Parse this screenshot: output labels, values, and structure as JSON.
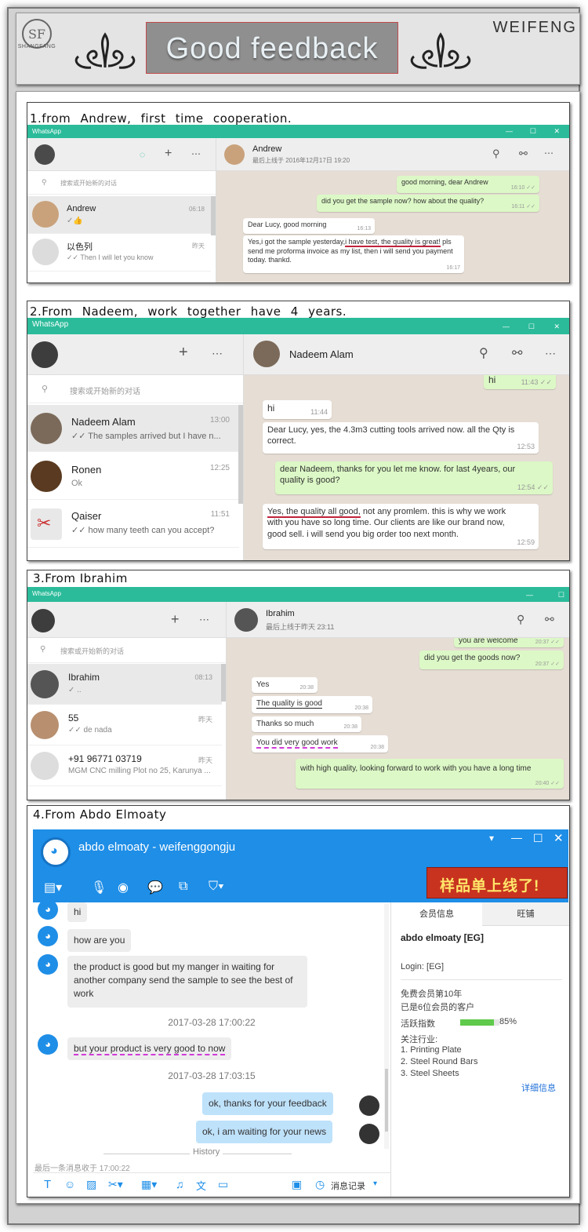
{
  "header": {
    "logo_text": "SHANGFANG",
    "logo_letters": "SF",
    "title": "Good  feedback",
    "brand": "WEIFENG"
  },
  "colors": {
    "whatsapp": "#2bbb9a",
    "qq_blue": "#1e8ee7",
    "bubble_out": "#dcf8c6",
    "chat_bg": "#e6ddd4"
  },
  "s1": {
    "title": "1.from  Andrew,  first  time  cooperation.",
    "app_name": "WhatsApp",
    "search_placeholder": "搜索或开始新的对话",
    "header_name": "Andrew",
    "header_status": "最后上线于 2016年12月17日 19:20",
    "contacts": [
      {
        "name": "Andrew",
        "msg": "✓👍",
        "time": "06:18"
      },
      {
        "name": "以色列",
        "msg": "✓✓ Then I will let you know",
        "time": "昨天"
      }
    ],
    "messages": [
      {
        "text": "good morning, dear Andrew",
        "time": "16:10 ✓✓"
      },
      {
        "text": "did you get the sample now? how about the quality?",
        "time": "16:11 ✓✓"
      },
      {
        "text": "Dear Lucy, good morning",
        "time": "16:13"
      },
      {
        "pre": "Yes,i got the sample yesterday,",
        "hl": "i have test, the quality is great!",
        "post": " pls send me proforma invoice as my list, then i will send you payment today. thankd.",
        "time": "16:17"
      }
    ]
  },
  "s2": {
    "title": "2.From  Nadeem,  work  together  have  4  years.",
    "app_name": "WhatsApp",
    "search_placeholder": "搜索或开始新的对话",
    "header_name": "Nadeem Alam",
    "contacts": [
      {
        "name": "Nadeem Alam",
        "msg": "✓✓ The samples arrived but I have n...",
        "time": "13:00"
      },
      {
        "name": "Ronen",
        "msg": "Ok",
        "time": "12:25"
      },
      {
        "name": "Qaiser",
        "msg": "✓✓ how many teeth can you accept?",
        "time": "11:51"
      }
    ],
    "messages": [
      {
        "text": "hi",
        "time": "11:43 ✓✓"
      },
      {
        "text": "hi",
        "time": "11:44"
      },
      {
        "text": "Dear Lucy, yes, the 4.3m3 cutting tools arrived now. all the Qty is correct.",
        "time": "12:53"
      },
      {
        "text": "dear Nadeem, thanks for you let me know. for last 4years, our quality is good?",
        "time": "12:54 ✓✓"
      },
      {
        "hl": "Yes, the quality all good,",
        "post": " not any promlem. this is  why we work with you have so long time. Our clients are like our brand now, good sell. i will send you big order too next month.",
        "time": "12:59"
      }
    ]
  },
  "s3": {
    "title": "3.From Ibrahim",
    "app_name": "WhatsApp",
    "search_placeholder": "搜索或开始新的对话",
    "header_name": "Ibrahim",
    "header_status": "最后上线于昨天 23:11",
    "contacts": [
      {
        "name": "Ibrahim",
        "msg": "✓ ..",
        "time": "08:13"
      },
      {
        "name": "55",
        "msg": "✓✓ de nada",
        "time": "昨天"
      },
      {
        "name": "+91 96771 03719",
        "msg": "MGM CNC milling Plot no 25, Karunya ...",
        "time": "昨天"
      }
    ],
    "messages": [
      {
        "text": "you are welcome",
        "time": "20:37 ✓✓"
      },
      {
        "text": "did you get the goods now?",
        "time": "20:37 ✓✓"
      },
      {
        "text": "Yes",
        "time": "20:38"
      },
      {
        "text": "The quality is good",
        "time": "20:38"
      },
      {
        "text": "Thanks so much",
        "time": "20:38"
      },
      {
        "text": "You did very good work",
        "time": "20:38"
      },
      {
        "text": "with high quality, looking forward to work with you have a long time",
        "time": "20:40 ✓✓"
      }
    ]
  },
  "s4": {
    "title": "4.From Abdo Elmoaty",
    "window_title": "abdo elmoaty - weifenggongju",
    "banner": "样品单上线了!",
    "tabs": [
      "会员信息",
      "旺铺"
    ],
    "profile_name": "abdo elmoaty  [EG]",
    "login": "Login: [EG]",
    "member_lines": [
      "免费会员第10年",
      "已是6位会员的客户"
    ],
    "activity_label": "活跃指数",
    "activity_value": "85%",
    "activity_fraction": 0.85,
    "industry_label": "关注行业:",
    "industries": [
      "1. Printing Plate",
      "2. Steel Round Bars",
      "3. Steel Sheets"
    ],
    "detail_link": "详细信息",
    "messages": [
      {
        "text": "hi"
      },
      {
        "text": "how are you"
      },
      {
        "text": "the product is good but my manger in waiting for another company send the sample to see the best of work"
      },
      {
        "text": "but your product is very good to now"
      },
      {
        "text": "ok, thanks for your feedback"
      },
      {
        "text": "ok, i am waiting for your news"
      }
    ],
    "times": [
      "2017-03-28 17:00:22",
      "2017-03-28 17:03:15"
    ],
    "history": "History",
    "last_msg": "最后一条消息收于 17:00:22",
    "record_label": "消息记录"
  }
}
